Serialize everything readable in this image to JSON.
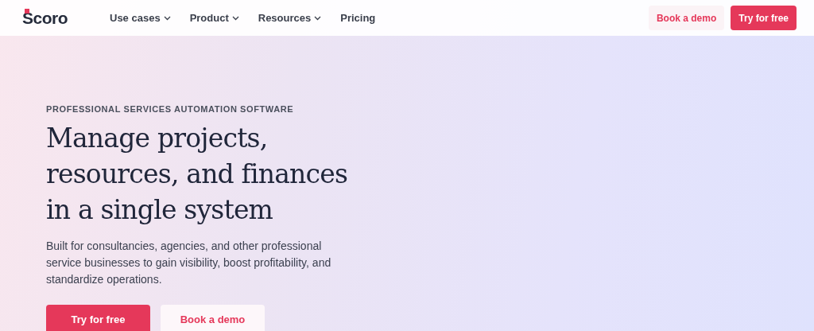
{
  "header": {
    "logo": "Scoro",
    "nav": [
      {
        "label": "Use cases",
        "has_menu": true
      },
      {
        "label": "Product",
        "has_menu": true
      },
      {
        "label": "Resources",
        "has_menu": true
      },
      {
        "label": "Pricing",
        "has_menu": false
      }
    ],
    "actions": [
      {
        "label": "Book a demo",
        "kind": "secondary"
      },
      {
        "label": "Try for free",
        "kind": "primary"
      }
    ]
  },
  "hero": {
    "eyebrow": "PROFESSIONAL SERVICES AUTOMATION SOFTWARE",
    "heading_lines": [
      "Manage projects,",
      "resources, and finances",
      "in a single system"
    ],
    "description": "Built for consultancies, agencies, and other professional service businesses to gain visibility, boost profitability, and standardize operations.",
    "actions": [
      {
        "label": "Try for free",
        "kind": "primary"
      },
      {
        "label": "Book a demo",
        "kind": "secondary"
      }
    ]
  }
}
